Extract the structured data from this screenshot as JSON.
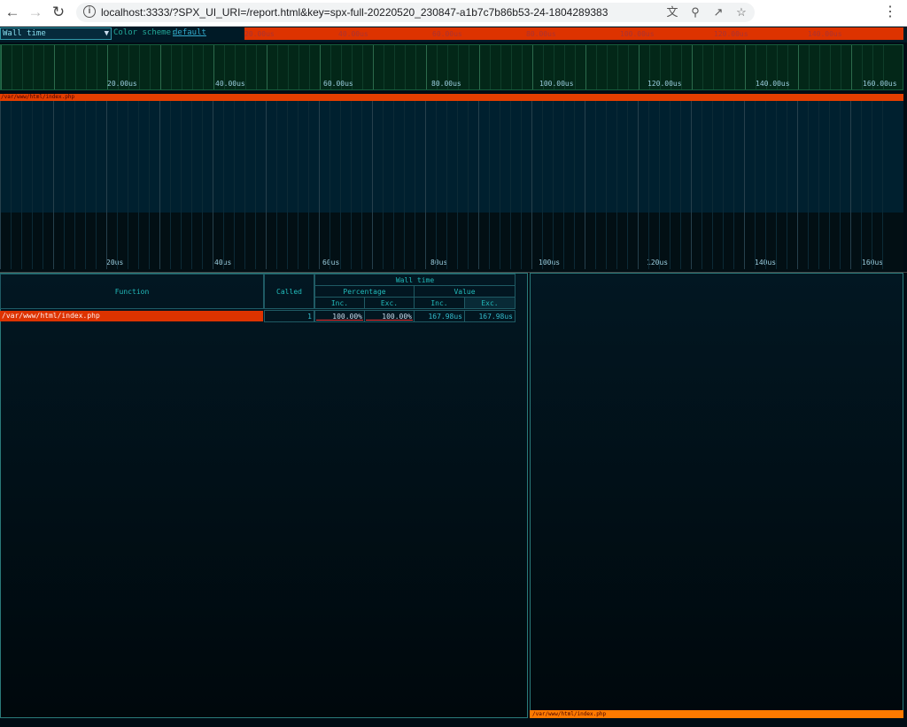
{
  "browser": {
    "url": "localhost:3333/?SPX_UI_URI=/report.html&key=spx-full-20220520_230847-a1b7c7b86b53-24-1804289383",
    "icons": [
      "back-icon",
      "forward-icon",
      "reload-icon",
      "info-icon",
      "translate-icon",
      "zoom-icon",
      "share-icon",
      "star-icon",
      "menu-icon"
    ]
  },
  "toolbar": {
    "metric_selected": "Wall time",
    "color_scheme_label": "Color scheme:",
    "color_scheme_value": "default"
  },
  "overview": {
    "ticks": [
      "20.00us",
      "40.00us",
      "60.00us",
      "80.00us",
      "100.00us",
      "120.00us",
      "140.00us"
    ]
  },
  "timeline": {
    "ticks": [
      "20.00us",
      "40.00us",
      "60.00us",
      "80.00us",
      "100.00us",
      "120.00us",
      "140.00us",
      "160.00us"
    ]
  },
  "flamegraph": {
    "root_label": "/var/www/html/index.php",
    "ticks": [
      "20us",
      "40us",
      "60us",
      "80us",
      "100us",
      "120us",
      "140us",
      "160us"
    ]
  },
  "table": {
    "headers": {
      "function": "Function",
      "called": "Called",
      "group": "Wall time",
      "percentage": "Percentage",
      "value": "Value",
      "inc": "Inc.",
      "exc": "Exc."
    },
    "rows": [
      {
        "function": "/var/www/html/index.php",
        "called": "1",
        "pct_inc": "100.00%",
        "pct_exc": "100.00%",
        "val_inc": "167.98us",
        "val_exc": "167.98us"
      }
    ]
  },
  "side_panel": {
    "footer_label": "/var/www/html/index.php"
  },
  "colors": {
    "accent": "#dd3300",
    "footer": "#ff7a00",
    "background": "#000c14"
  }
}
